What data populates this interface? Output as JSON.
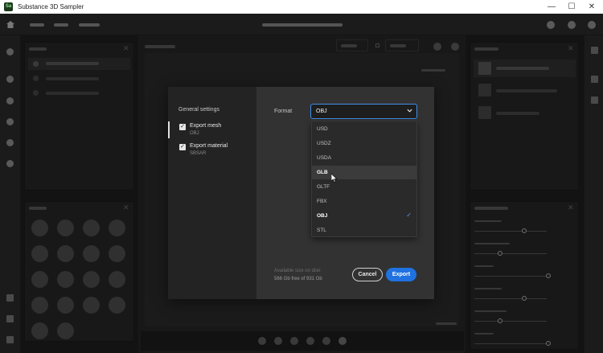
{
  "window": {
    "app_icon_text": "Sa",
    "title": "Substance 3D Sampler",
    "minimize_glyph": "—",
    "maximize_glyph": "☐",
    "close_glyph": "✕"
  },
  "panels": {
    "close_glyph": "✕"
  },
  "dialog": {
    "section_heading": "General settings",
    "items": [
      {
        "label": "Export mesh",
        "sub": "OBJ",
        "checked": true
      },
      {
        "label": "Export material",
        "sub": "SBSAR",
        "checked": true
      }
    ],
    "checkbox_glyph": "✓",
    "format_label": "Format",
    "format_value": "OBJ",
    "format_options": [
      {
        "label": "USD"
      },
      {
        "label": "USDZ"
      },
      {
        "label": "USDA"
      },
      {
        "label": "GLB"
      },
      {
        "label": "GLTF"
      },
      {
        "label": "FBX"
      },
      {
        "label": "OBJ"
      },
      {
        "label": "STL"
      }
    ],
    "hovered_option": "GLB",
    "selected_option": "OBJ",
    "selected_check_glyph": "✓",
    "disk_title": "Available size on disk:",
    "disk_value": "566 Gb free of 931 Gb",
    "cancel_label": "Cancel",
    "export_label": "Export"
  },
  "colors": {
    "accent": "#1f72e0",
    "focus_border": "#3f8ee8",
    "check": "#4a9ef5"
  }
}
